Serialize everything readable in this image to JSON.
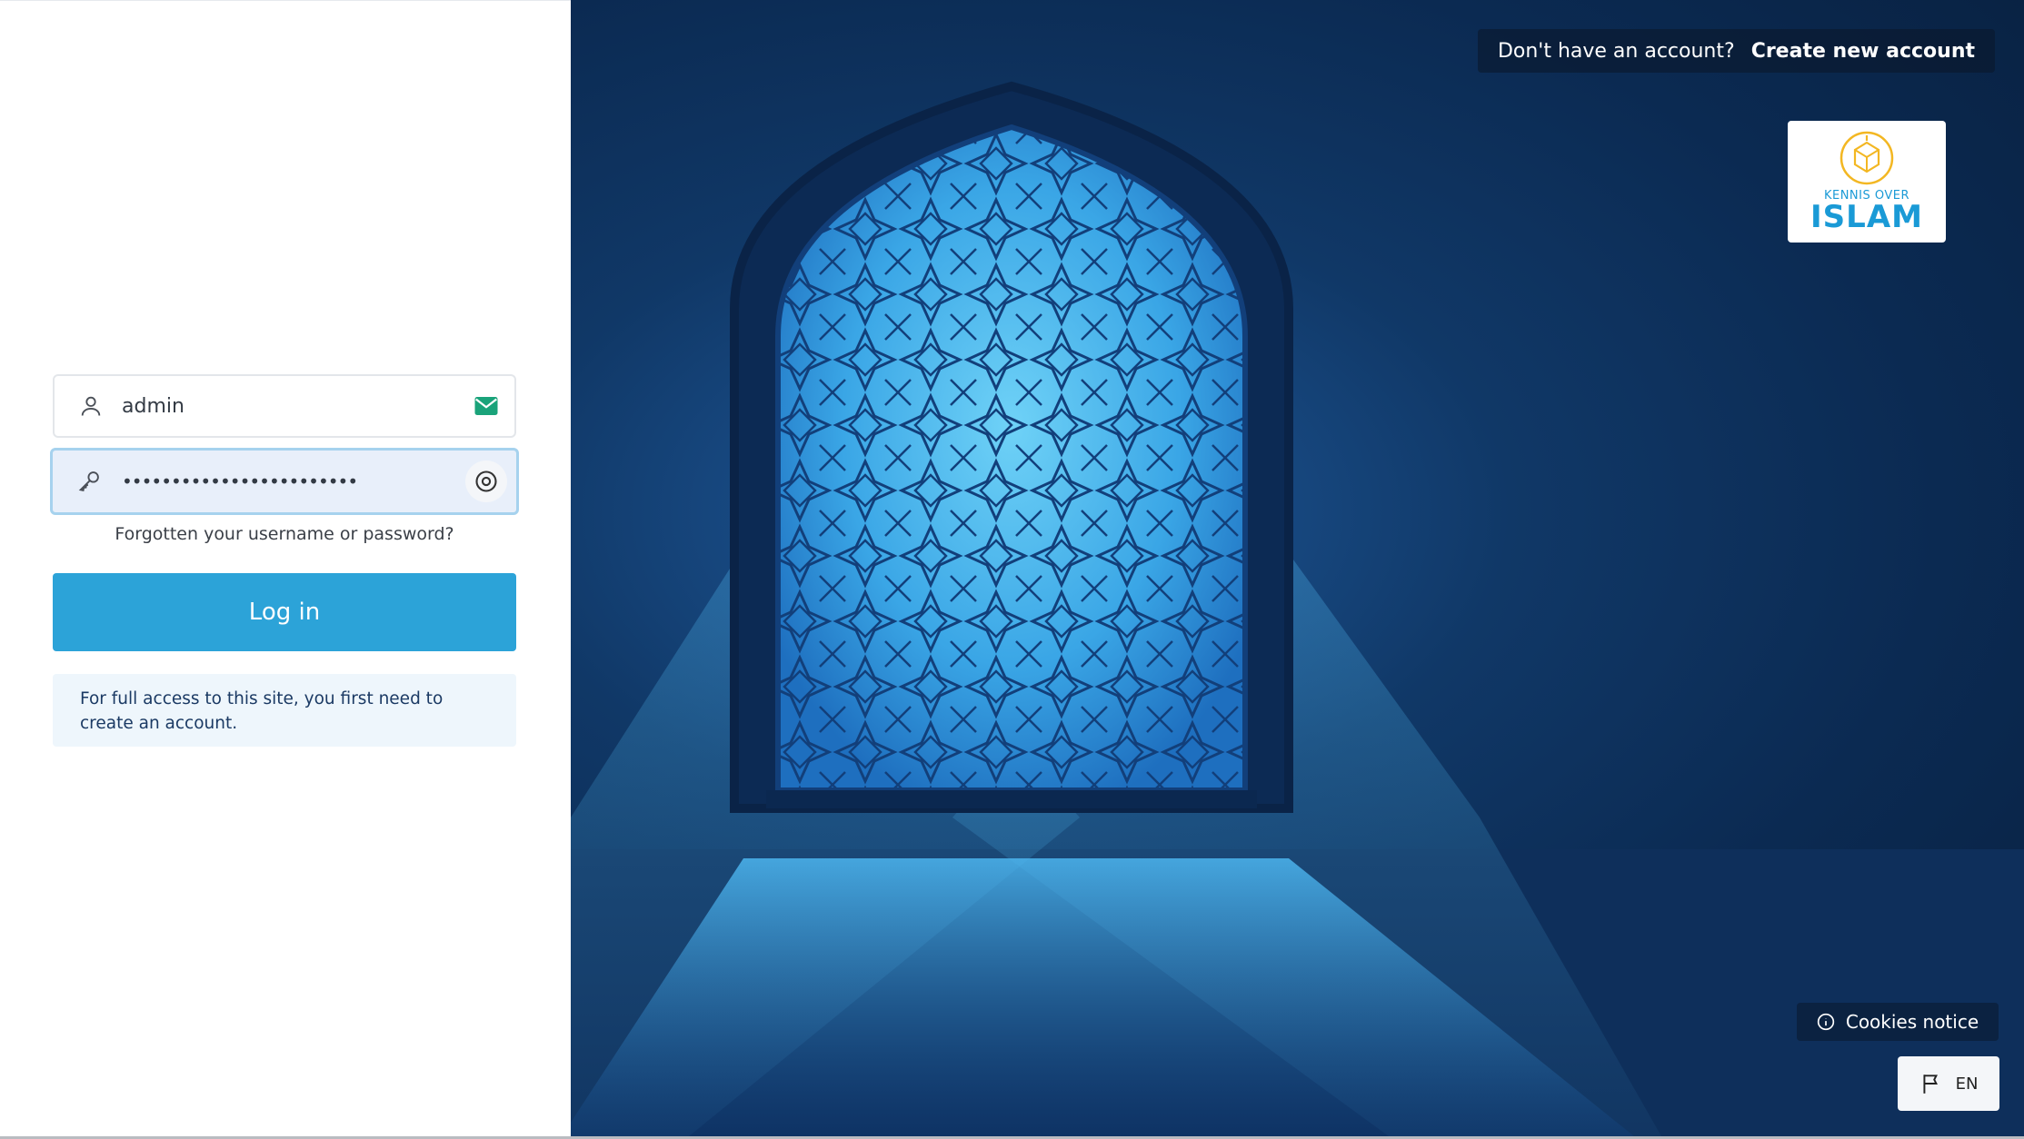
{
  "login": {
    "username_value": "admin",
    "password_value": "••••••••••••••••••••••••",
    "forgot_link": "Forgotten your username or password?",
    "login_button": "Log in",
    "notice": "For full access to this site, you first need to create an account."
  },
  "header": {
    "signup_prompt": "Don't have an account?",
    "create_account_link": "Create new account"
  },
  "logo": {
    "line1": "KENNIS OVER",
    "line2": "ISLAM"
  },
  "footer": {
    "cookies_notice": "Cookies notice",
    "language": "EN"
  },
  "colors": {
    "primary": "#2ca3d8",
    "notice_bg": "#eef6fc",
    "hero_dark": "#0b2a52"
  },
  "icons": {
    "username": "user-icon",
    "username_trailing": "mail-icon",
    "password": "key-icon",
    "password_trailing": "eye-icon",
    "cookies": "info-icon",
    "language": "flag-icon"
  }
}
